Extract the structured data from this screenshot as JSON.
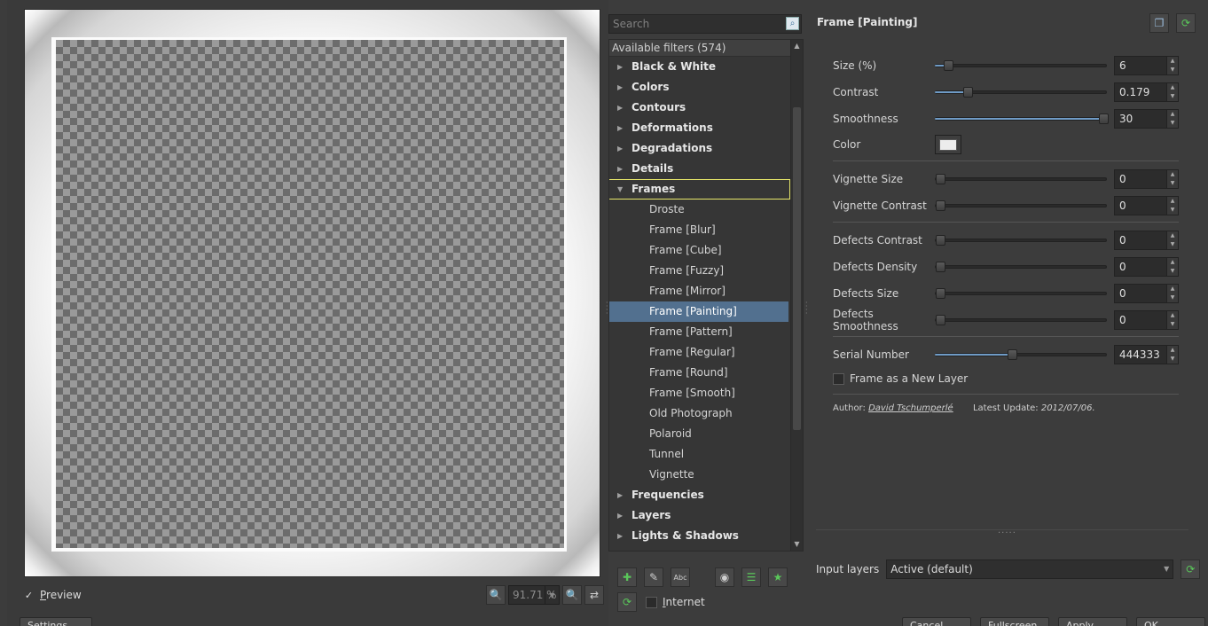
{
  "preview": {
    "checkbox_mark": "✓",
    "label": "Preview",
    "zoom": "91.71 %"
  },
  "bottom_left": {
    "label": "Settings"
  },
  "search": {
    "placeholder": "Search"
  },
  "tree": {
    "header": "Available filters (574)",
    "items": [
      {
        "label": "Black & White",
        "type": "category",
        "expanded": false
      },
      {
        "label": "Colors",
        "type": "category",
        "expanded": false
      },
      {
        "label": "Contours",
        "type": "category",
        "expanded": false
      },
      {
        "label": "Deformations",
        "type": "category",
        "expanded": false
      },
      {
        "label": "Degradations",
        "type": "category",
        "expanded": false
      },
      {
        "label": "Details",
        "type": "category",
        "expanded": false
      },
      {
        "label": "Frames",
        "type": "category",
        "expanded": true,
        "focused": true
      },
      {
        "label": "Droste",
        "type": "filter"
      },
      {
        "label": "Frame [Blur]",
        "type": "filter"
      },
      {
        "label": "Frame [Cube]",
        "type": "filter"
      },
      {
        "label": "Frame [Fuzzy]",
        "type": "filter"
      },
      {
        "label": "Frame [Mirror]",
        "type": "filter"
      },
      {
        "label": "Frame [Painting]",
        "type": "filter",
        "selected": true
      },
      {
        "label": "Frame [Pattern]",
        "type": "filter"
      },
      {
        "label": "Frame [Regular]",
        "type": "filter"
      },
      {
        "label": "Frame [Round]",
        "type": "filter"
      },
      {
        "label": "Frame [Smooth]",
        "type": "filter"
      },
      {
        "label": "Old Photograph",
        "type": "filter"
      },
      {
        "label": "Polaroid",
        "type": "filter"
      },
      {
        "label": "Tunnel",
        "type": "filter"
      },
      {
        "label": "Vignette",
        "type": "filter"
      },
      {
        "label": "Frequencies",
        "type": "category",
        "expanded": false
      },
      {
        "label": "Layers",
        "type": "category",
        "expanded": false
      },
      {
        "label": "Lights & Shadows",
        "type": "category",
        "expanded": false
      }
    ]
  },
  "internet": {
    "label": "Internet"
  },
  "filter": {
    "title": "Frame [Painting]",
    "params": [
      {
        "label": "Size (%)",
        "value": "6",
        "fraction": 0.06
      },
      {
        "label": "Contrast",
        "value": "0.179",
        "fraction": 0.179
      },
      {
        "label": "Smoothness",
        "value": "30",
        "fraction": 1.0
      },
      {
        "label": "Color",
        "swatch": "#ececec"
      },
      {
        "label": "Vignette Size",
        "value": "0",
        "fraction": 0
      },
      {
        "label": "Vignette Contrast",
        "value": "0",
        "fraction": 0
      },
      {
        "label": "Defects Contrast",
        "value": "0",
        "fraction": 0
      },
      {
        "label": "Defects Density",
        "value": "0",
        "fraction": 0
      },
      {
        "label": "Defects Size",
        "value": "0",
        "fraction": 0
      },
      {
        "label": "Defects Smoothness",
        "value": "0",
        "fraction": 0
      },
      {
        "label": "Serial Number",
        "value": "444333",
        "fraction": 0.444
      }
    ],
    "new_layer_label": "Frame as a New Layer",
    "author_prefix": "Author:",
    "author_name": "David Tschumperlé",
    "update_prefix": "Latest Update:",
    "update_date": "2012/07/06."
  },
  "input_layers": {
    "label": "Input layers",
    "value": "Active (default)"
  },
  "bottom_buttons": [
    "Cancel",
    "Fullscreen",
    "Apply",
    "OK"
  ],
  "colors": {
    "selection": "#52708f",
    "focus_outline": "#e8e86a",
    "slider_fill": "#6f9bc6"
  }
}
